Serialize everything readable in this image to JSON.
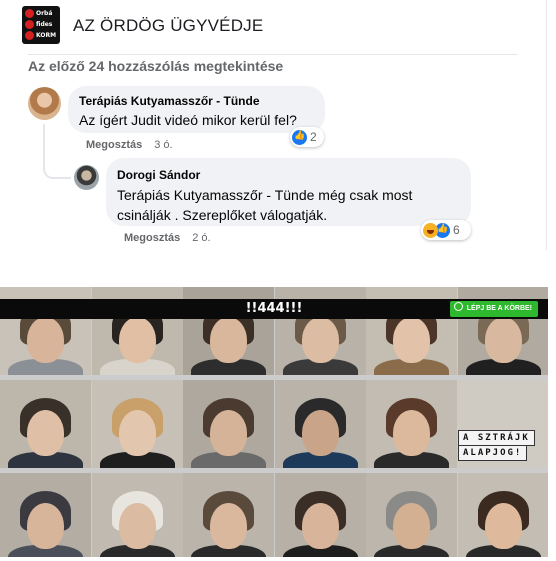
{
  "header": {
    "page_title": "AZ ÖRDÖG ÜGYVÉDJE",
    "logo_lines": [
      "Orbá",
      "fides",
      "KORM"
    ],
    "logo_red": "#d42020"
  },
  "comments": {
    "view_previous": "Az előző 24 hozzászólás megtekintése",
    "items": [
      {
        "author": "Terápiás Kutyamasszőr - Tünde",
        "text": "Az ígért Judit videó mikor kerül fel?",
        "reactions": "2",
        "share_label": "Megosztás",
        "time": "3 ó."
      },
      {
        "author": "Dorogi Sándor",
        "text": "Terápiás Kutyamasszőr - Tünde még csak most csinálják . Szereplőket válogatják.",
        "reactions": "6",
        "share_label": "Megosztás",
        "time": "2 ó."
      }
    ]
  },
  "post_image": {
    "banner_text": "!!444!!!",
    "cta_label": "LÉPJ BE A KÖRBE!",
    "sign_lines": [
      "A SZTRÁJK",
      "ALAPJOG!"
    ],
    "cta_color": "#2eb82e"
  },
  "icons": [
    "like-icon",
    "haha-icon"
  ]
}
